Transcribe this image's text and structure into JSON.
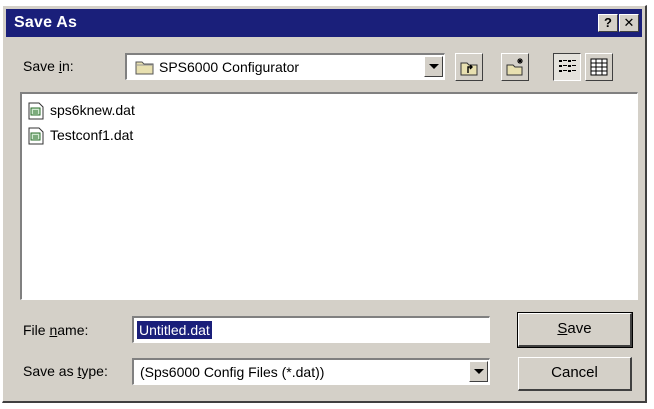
{
  "window": {
    "title": "Save As",
    "help_label": "?",
    "close_label": "✕"
  },
  "location": {
    "label_before": "Save ",
    "label_accel": "i",
    "label_after": "n:",
    "value": "SPS6000 Configurator"
  },
  "toolbar": {
    "icons": [
      "up-one-level-icon",
      "create-new-folder-icon",
      "list-view-icon",
      "details-view-icon"
    ],
    "active": "list-view-icon"
  },
  "files": [
    {
      "name": "sps6knew.dat",
      "icon": "data-file-icon"
    },
    {
      "name": "Testconf1.dat",
      "icon": "data-file-icon"
    }
  ],
  "filename": {
    "label_before": "File ",
    "label_accel": "n",
    "label_after": "ame:",
    "value": "Untitled.dat"
  },
  "filetype": {
    "label_before": "Save as ",
    "label_accel": "t",
    "label_after": "ype:",
    "value": "(Sps6000 Config Files (*.dat))"
  },
  "buttons": {
    "save_accel": "S",
    "save_rest": "ave",
    "cancel": "Cancel"
  },
  "colors": {
    "titlebar": "#1a1f7a",
    "face": "#d4d0c8",
    "selection": "#1a1f7a"
  }
}
